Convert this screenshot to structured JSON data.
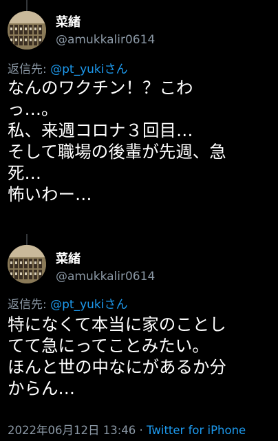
{
  "tweets": [
    {
      "display_name": "菜緒",
      "handle": "@amukkalir0614",
      "reply_prefix": "返信先: ",
      "reply_to": "@pt_yukiさん",
      "body_lines": [
        "なんのワクチン！？こわ",
        "っ…。",
        "私、来週コロナ３回目…",
        "そして職場の後輩が先週、急",
        "死…",
        "怖いわー…"
      ]
    },
    {
      "display_name": "菜緒",
      "handle": "@amukkalir0614",
      "reply_prefix": "返信先: ",
      "reply_to": "@pt_yukiさん",
      "body_lines": [
        "特になくて本当に家のことし",
        "てて急にってことみたい。",
        "ほんと世の中なにがあるか分",
        "からん…"
      ]
    }
  ],
  "footer": {
    "timestamp": "2022年06月12日 13:46",
    "separator": "·",
    "source": "Twitter for iPhone"
  },
  "colors": {
    "background": "#000000",
    "text": "#ffffff",
    "secondary": "#8b98a5",
    "link": "#1d9bf0"
  }
}
